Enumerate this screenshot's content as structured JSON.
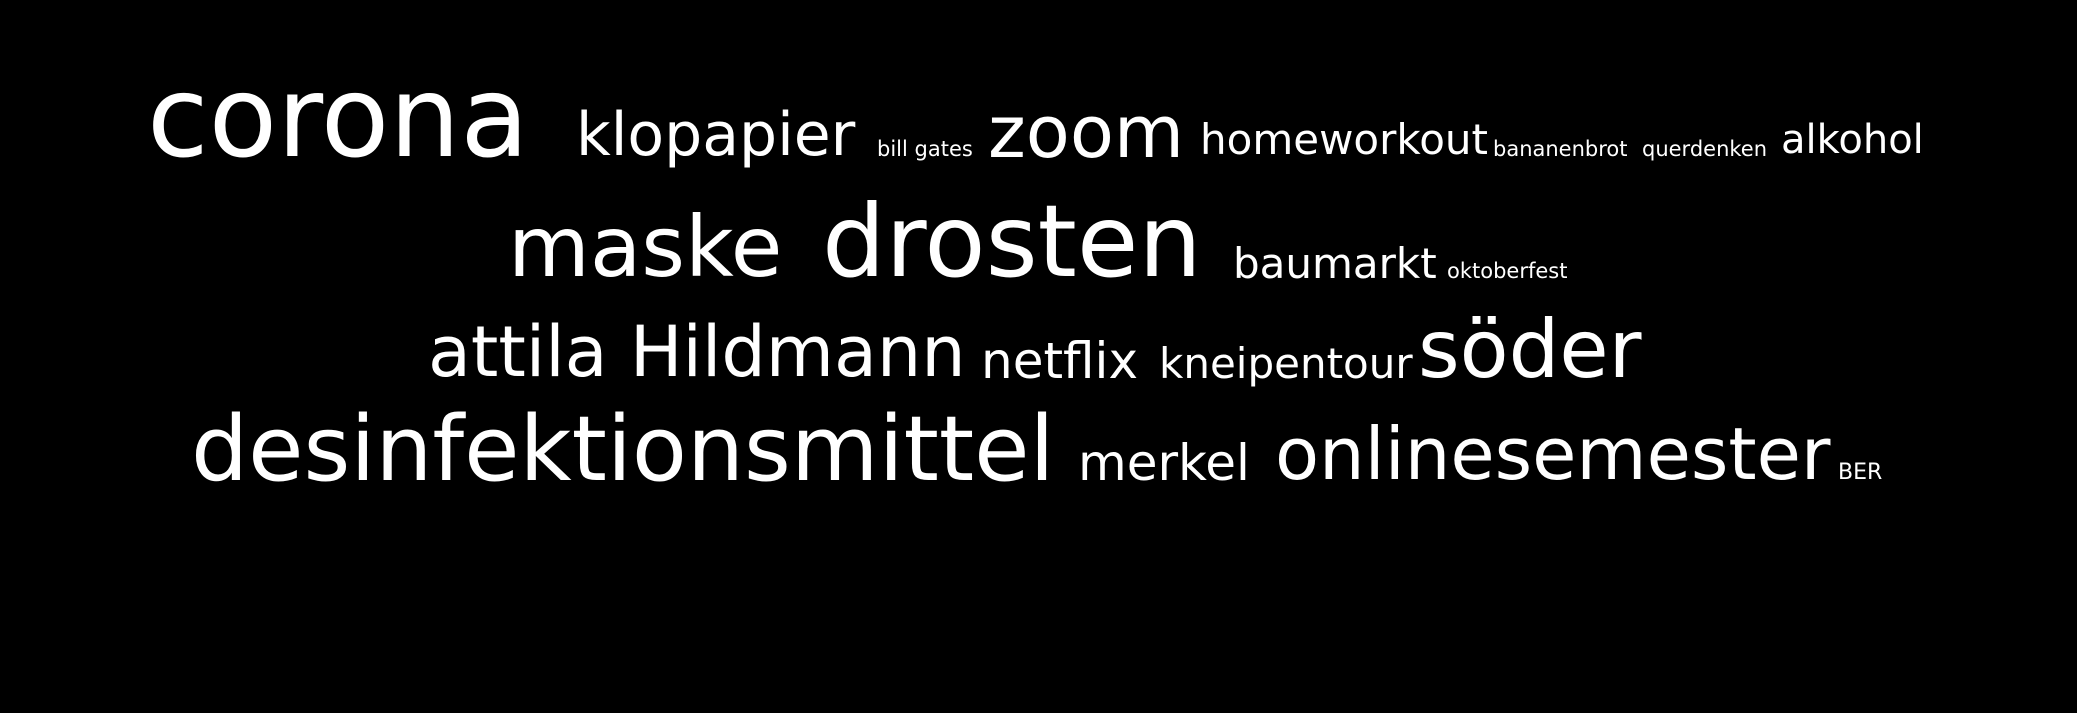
{
  "background_color": "#000000",
  "text_color": "#ffffff",
  "words": [
    {
      "id": "corona",
      "text": "corona"
    },
    {
      "id": "klopapier",
      "text": "klopapier"
    },
    {
      "id": "bill-gates",
      "text": "bill gates"
    },
    {
      "id": "zoom",
      "text": "zoom"
    },
    {
      "id": "homeworkout",
      "text": "homeworkout"
    },
    {
      "id": "bananenbrot",
      "text": "bananenbrot"
    },
    {
      "id": "querdenken",
      "text": "querdenken"
    },
    {
      "id": "alkohol",
      "text": "alkohol"
    },
    {
      "id": "maske",
      "text": "maske"
    },
    {
      "id": "drosten",
      "text": "drosten"
    },
    {
      "id": "baumarkt",
      "text": "baumarkt"
    },
    {
      "id": "oktoberfest",
      "text": "oktoberfest"
    },
    {
      "id": "attila-hildmann",
      "text": "attila Hildmann"
    },
    {
      "id": "netflix",
      "text": "netflix"
    },
    {
      "id": "kneipentour",
      "text": "kneipentour"
    },
    {
      "id": "soeder",
      "text": "söder"
    },
    {
      "id": "desinfektionsmittel",
      "text": "desinfektionsmittel"
    },
    {
      "id": "merkel",
      "text": "merkel"
    },
    {
      "id": "onlinesemester",
      "text": "onlinesemester"
    },
    {
      "id": "ber",
      "text": "BER"
    }
  ]
}
